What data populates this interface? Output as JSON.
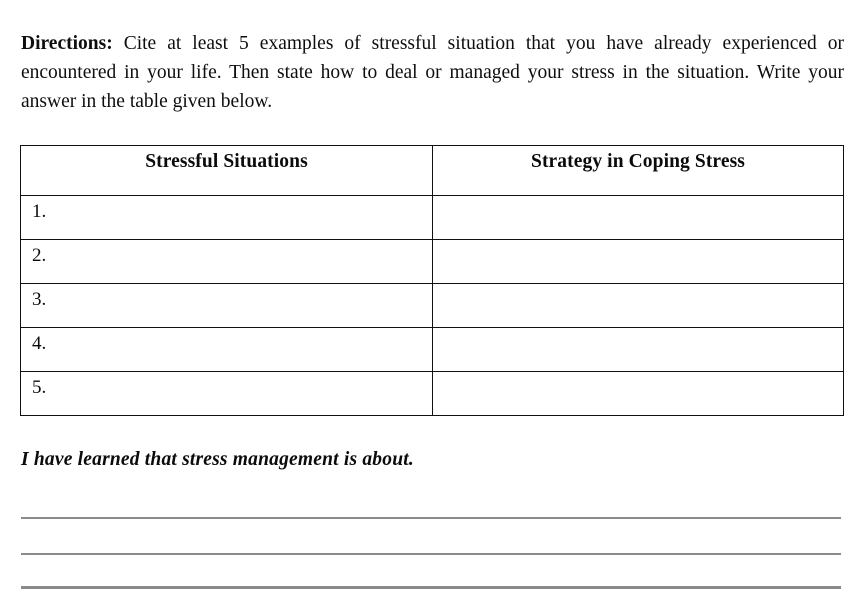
{
  "document": {
    "directions": {
      "label": "Directions:",
      "body": " Cite at least 5 examples of stressful situation that you have already experienced or encountered in your life. Then state how to deal or managed your stress in the situation. Write your answer in the table given below."
    },
    "table": {
      "headers": {
        "col1": "Stressful Situations",
        "col2": "Strategy in Coping Stress"
      },
      "rows": [
        {
          "number": "1.",
          "situation": "",
          "strategy": ""
        },
        {
          "number": "2.",
          "situation": "",
          "strategy": ""
        },
        {
          "number": "3.",
          "situation": "",
          "strategy": ""
        },
        {
          "number": "4.",
          "situation": "",
          "strategy": ""
        },
        {
          "number": "5.",
          "situation": "",
          "strategy": ""
        }
      ]
    },
    "reflection": {
      "prompt": "I have learned that stress management is about.",
      "answer_lines": [
        "",
        "",
        ""
      ]
    },
    "colors": {
      "text": "#0e0e0e",
      "table_border": "#111111",
      "answer_rule": "#8a8a8a",
      "background": "#ffffff"
    }
  }
}
